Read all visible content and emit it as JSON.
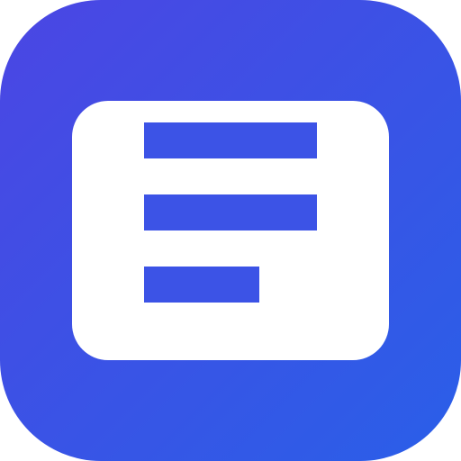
{
  "icon": {
    "name": "document-lines-app-icon",
    "gradient_start": "#4B46E3",
    "gradient_end": "#2A5FE8",
    "card_color": "#FFFFFF",
    "line_color": "#3C53E6",
    "line_count": 3
  }
}
